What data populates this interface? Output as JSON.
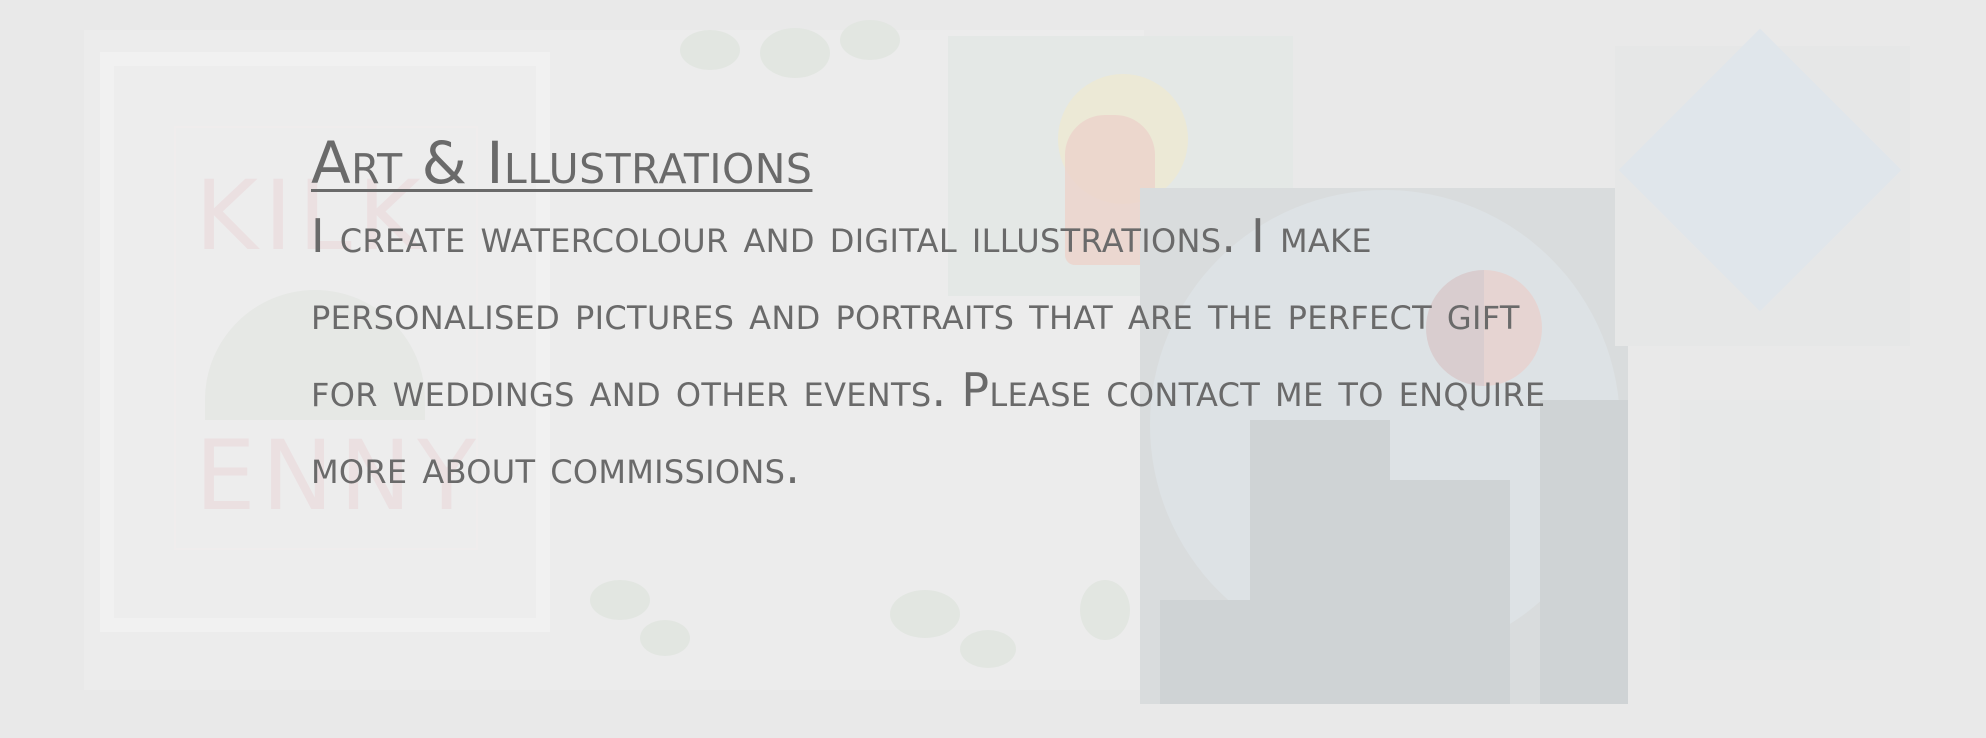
{
  "section": {
    "heading": "Art & Illustrations",
    "body": "I create watercolour and digital illustrations. I make personalised pictures and portraits that are the perfect gift for weddings and other events. Please contact me to enquire more about commissions."
  },
  "background": {
    "frame_text_top": "KILK",
    "frame_text_bottom": "ENNY"
  }
}
